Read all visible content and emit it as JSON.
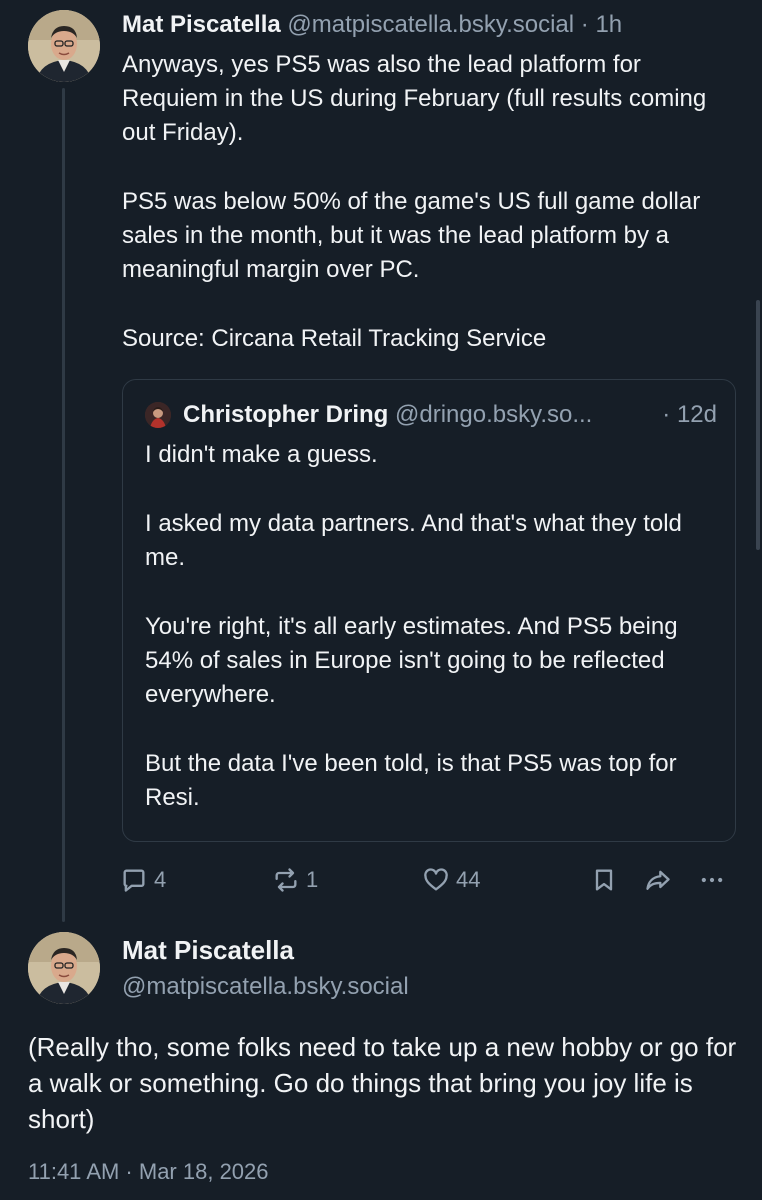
{
  "thread": {
    "parent_post": {
      "author_name": "Mat Piscatella",
      "author_handle": "@matpiscatella.bsky.social",
      "separator": "·",
      "age": "1h",
      "paragraphs": [
        "Anyways, yes PS5 was also the lead platform for Requiem in the US during February (full results coming out Friday).",
        "PS5 was below 50% of the game's US full game dollar sales in the month, but it was the lead platform by a meaningful margin over PC.",
        "Source: Circana Retail Tracking Service"
      ],
      "quote": {
        "author_name": "Christopher Dring",
        "author_handle": "@dringo.bsky.so...",
        "separator": "·",
        "age": "12d",
        "paragraphs": [
          "I didn't make a guess.",
          "I asked my data partners. And that's what they told me.",
          "You're right, it's all early estimates. And PS5 being 54% of sales in Europe isn't going to be reflected everywhere.",
          "But the data I've been told, is that PS5 was top for Resi."
        ]
      },
      "actions": {
        "replies": "4",
        "reposts": "1",
        "likes": "44",
        "icons": [
          "reply-icon",
          "repost-icon",
          "like-icon",
          "bookmark-icon",
          "share-icon",
          "more-icon"
        ]
      }
    },
    "main_post": {
      "author_name": "Mat Piscatella",
      "author_handle": "@matpiscatella.bsky.social",
      "text": "(Really tho, some folks need to take up a new hobby or go for a walk or something. Go do things that bring you joy life is short)",
      "timestamp": "11:41 AM · Mar 18, 2026"
    }
  },
  "colors": {
    "background": "#161e27",
    "text": "#f1f3f5",
    "muted": "#93a1b0",
    "border": "#2f3a45"
  }
}
